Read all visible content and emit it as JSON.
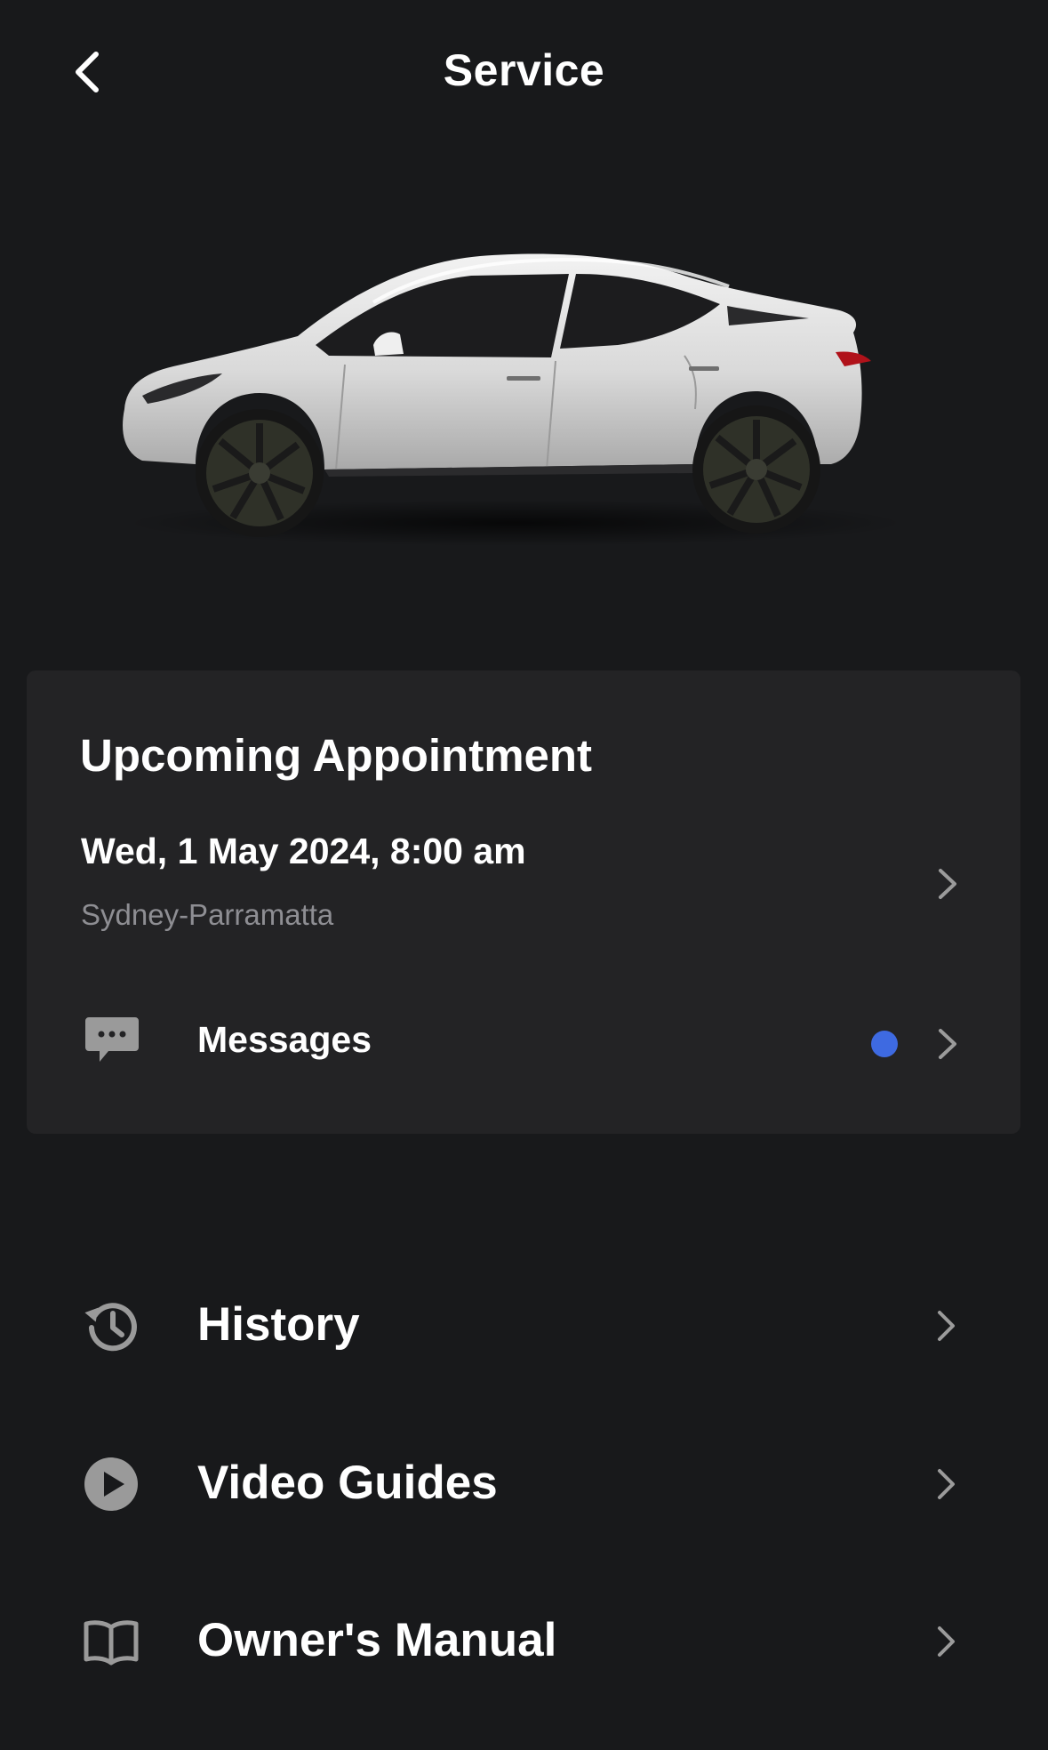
{
  "header": {
    "title": "Service",
    "back_icon": "chevron-left-icon"
  },
  "vehicle": {
    "image": "white-suv-side-view",
    "body_color": "#e6e6e6"
  },
  "appointment_card": {
    "heading": "Upcoming Appointment",
    "date": "Wed, 1 May 2024, 8:00 am",
    "location": "Sydney-Parramatta",
    "messages_label": "Messages",
    "messages_icon": "chat-bubble-icon",
    "unread_indicator_color": "#3e6ae1"
  },
  "menu": [
    {
      "label": "History",
      "icon": "history-clock-icon"
    },
    {
      "label": "Video Guides",
      "icon": "play-circle-icon"
    },
    {
      "label": "Owner's Manual",
      "icon": "open-book-icon"
    }
  ],
  "colors": {
    "background": "#18191b",
    "card": "#232325",
    "secondary_text": "#8e8e93",
    "accent": "#3e6ae1"
  }
}
